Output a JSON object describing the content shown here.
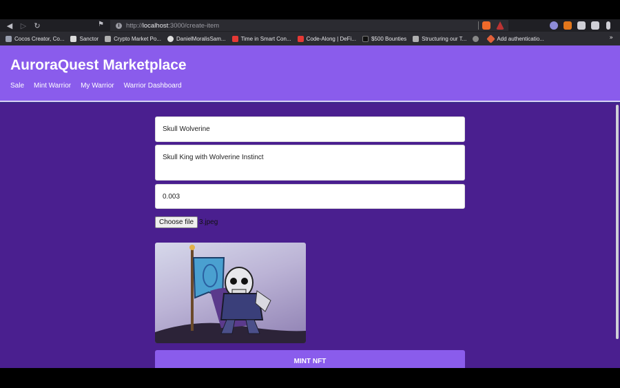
{
  "browser": {
    "url_prefix": "http://",
    "url_host": "localhost",
    "url_path": ":3000/create-item",
    "bookmarks": [
      {
        "label": "Cocos Creator, Co...",
        "color": "#9aa0b0"
      },
      {
        "label": "Sanctor",
        "color": "#dddddd"
      },
      {
        "label": "Crypto Market Po...",
        "color": "#b0b0b0"
      },
      {
        "label": "DanielMoralisSam...",
        "color": "#e0e0e0"
      },
      {
        "label": "Time in Smart Con...",
        "color": "#e53935"
      },
      {
        "label": "Code-Along | DeFi...",
        "color": "#e53935"
      },
      {
        "label": "$500 Bounties",
        "color": "#111111"
      },
      {
        "label": "Structuring our T...",
        "color": "#b0b0b0"
      },
      {
        "label": "",
        "color": "#888888"
      },
      {
        "label": "Add authenticatio...",
        "color": "#e0603a"
      }
    ]
  },
  "app": {
    "title": "AuroraQuest Marketplace",
    "nav": [
      "Sale",
      "Mint Warrior",
      "My Warrior",
      "Warrior Dashboard"
    ]
  },
  "form": {
    "name_value": "Skull Wolverine",
    "description_value": "Skull King with Wolverine Instinct",
    "price_value": "0.003",
    "choose_file_label": "Choose file",
    "file_name": "3.jpeg",
    "mint_label": "MINT NFT"
  }
}
